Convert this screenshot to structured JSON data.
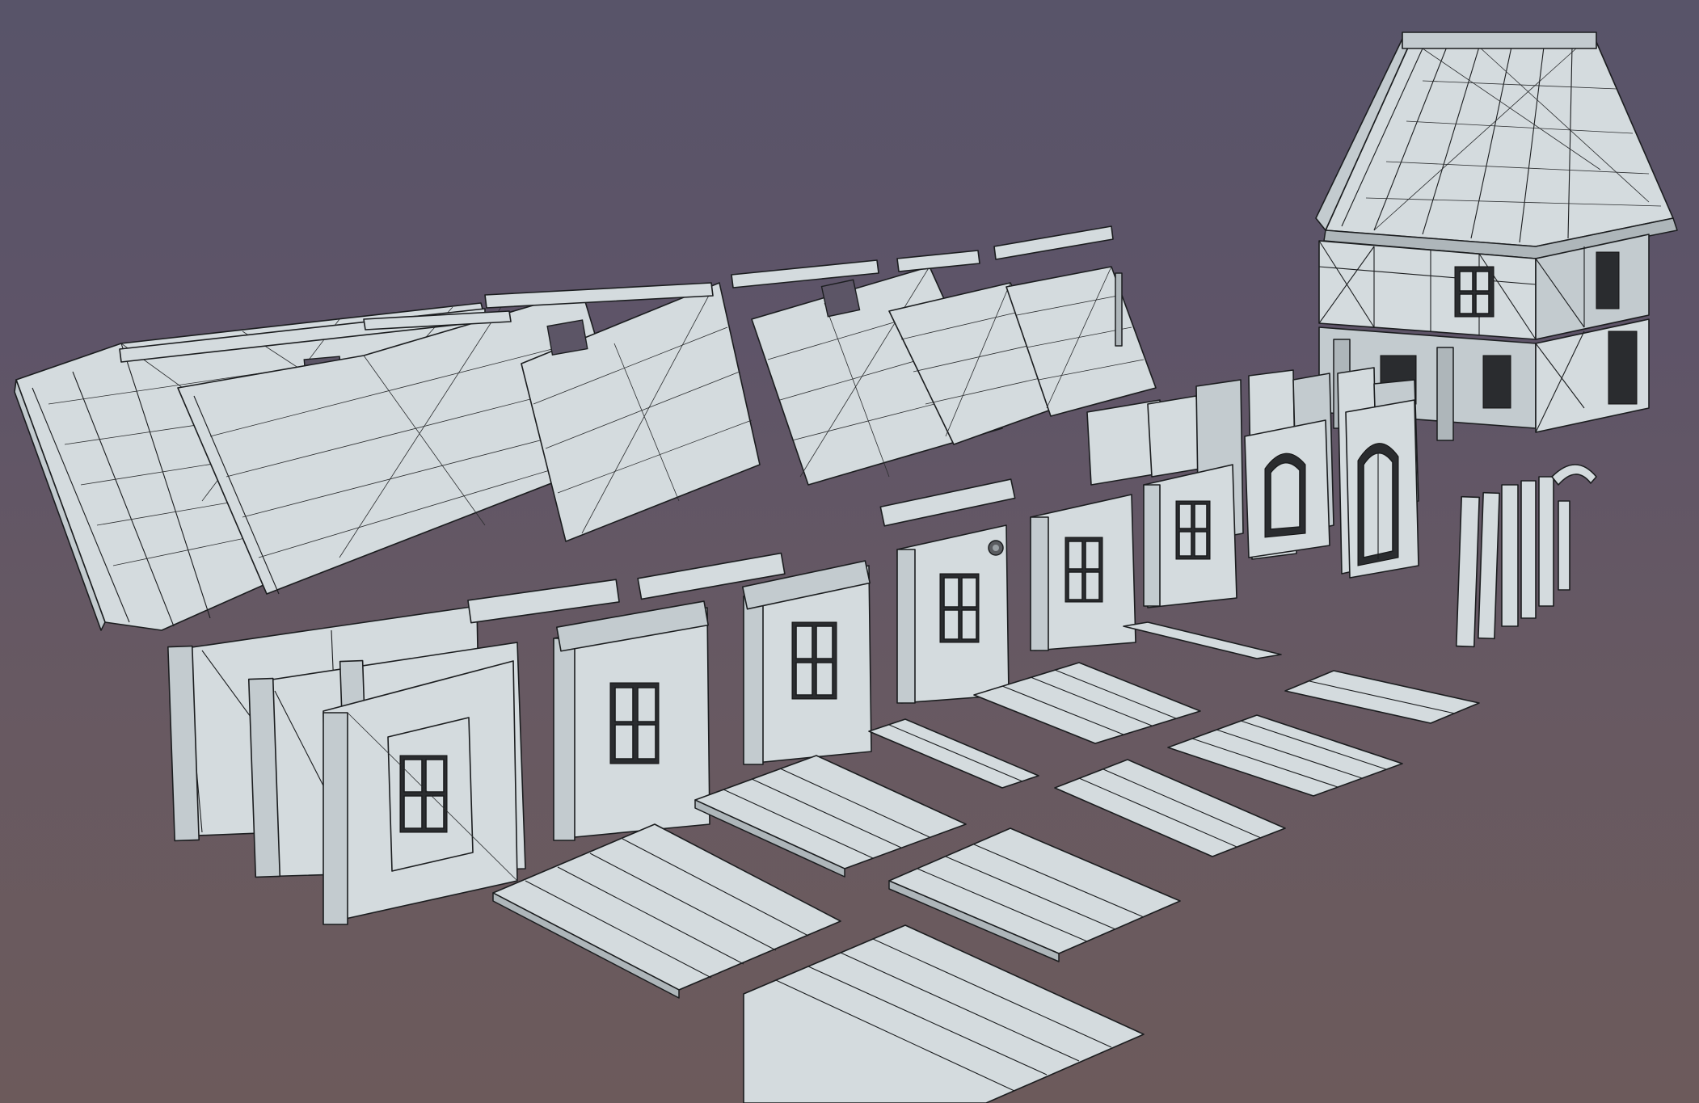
{
  "scene": {
    "type": "3d-viewport",
    "render_mode": "wireframe-on-shaded",
    "background_top": "#585469",
    "background_bottom": "#6c5a5b",
    "mesh_color": "#d4dbde",
    "edge_color": "#1b1d1f",
    "objects": [
      {
        "name": "roof-panels",
        "count": 6
      },
      {
        "name": "ridge-beams",
        "count": 7
      },
      {
        "name": "timber-frame-walls",
        "count": 5
      },
      {
        "name": "window-walls",
        "count": 6
      },
      {
        "name": "arched-doorways",
        "count": 2
      },
      {
        "name": "half-timbered-house",
        "count": 1
      },
      {
        "name": "floor-plank-panels",
        "count": 10
      },
      {
        "name": "wooden-posts",
        "count": 7
      }
    ]
  },
  "gizmo": {
    "icon": "pivot-point-icon"
  }
}
